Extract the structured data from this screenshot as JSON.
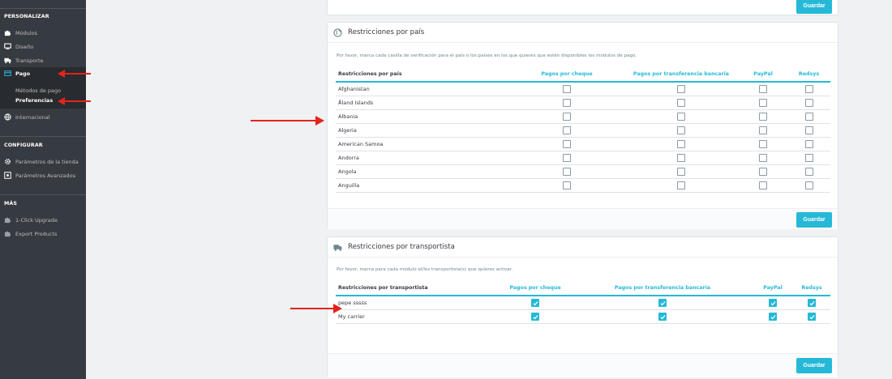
{
  "sidebar": {
    "sections": [
      {
        "title": "PERSONALIZAR"
      },
      {
        "title": "CONFIGURAR"
      },
      {
        "title": "MÁS"
      }
    ],
    "items": {
      "modulos": "Módulos",
      "diseno": "Diseño",
      "transporte": "Transporte",
      "pago": "Pago",
      "metodos": "Métodos de pago",
      "preferencias": "Preferencias",
      "internacional": "Internacional",
      "parametros_tienda": "Parámetros de la tienda",
      "parametros_avanzados": "Parámetros Avanzados",
      "upgrade": "1-Click Upgrade",
      "export": "Export Products"
    }
  },
  "top_panel": {
    "save_label": "Guardar"
  },
  "country_panel": {
    "title": "Restricciones por país",
    "description": "Por favor, marca cada casilla de verificación para el país o los países en los que quieres que estén disponibles los módulos de pago.",
    "columns": [
      "Restricciones por país",
      "Pagos por cheque",
      "Pagos por transferencia bancaria",
      "PayPal",
      "Redsys"
    ],
    "rows": [
      "Afghanistan",
      "Åland Islands",
      "Albania",
      "Algeria",
      "American Samoa",
      "Andorra",
      "Angola",
      "Anguilla"
    ],
    "save_label": "Guardar"
  },
  "carrier_panel": {
    "title": "Restricciones por transportista",
    "description": "Por favor, marca para cada módulo el/los transportista(s) que quieres activar.",
    "columns": [
      "Restricciones por transportista",
      "Pagos por cheque",
      "Pagos por transferencia bancaria",
      "PayPal",
      "Redsys"
    ],
    "rows": [
      "pepe sssss",
      "My carrier"
    ],
    "save_label": "Guardar"
  },
  "colors": {
    "accent": "#25b9d7",
    "sidebar_bg": "#363a41",
    "arrow": "#e3241b"
  }
}
